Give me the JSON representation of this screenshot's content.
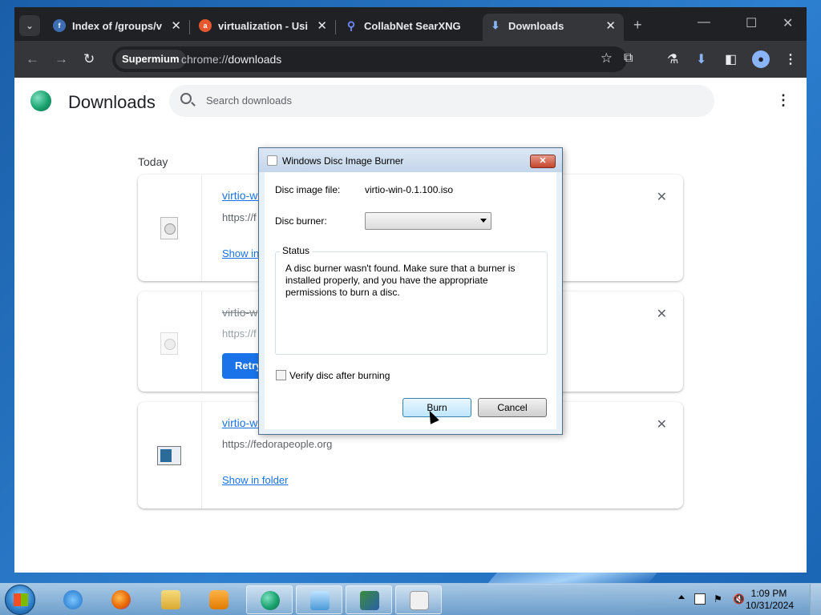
{
  "browser": {
    "tabs": [
      {
        "label": "Index of /groups/virt",
        "favicon": "fedora-icon",
        "color": "#3c6eb4"
      },
      {
        "label": "virtualization - Using",
        "favicon": "askfedora-icon",
        "color": "#e8572e"
      },
      {
        "label": "CollabNet SearXNG",
        "favicon": "search-icon",
        "color": "#3050ff"
      },
      {
        "label": "Downloads",
        "favicon": "download-icon",
        "color": "#8ab4f8"
      }
    ],
    "omnibox": {
      "chip": "Supermium",
      "url_scheme": "chrome://",
      "url_path": "downloads"
    }
  },
  "downloads": {
    "title": "Downloads",
    "search_placeholder": "Search downloads",
    "date_header": "Today",
    "items": [
      {
        "name": "virtio-wi",
        "url": "https://f",
        "action": "Show in"
      },
      {
        "name": "virtio-w",
        "url": "https://f",
        "action": "Retry"
      },
      {
        "name": "virtio-wi",
        "url": "https://fedorapeople.org",
        "action": "Show in folder"
      }
    ]
  },
  "dialog": {
    "title": "Windows Disc Image Burner",
    "disc_image_label": "Disc image file:",
    "disc_image_value": "virtio-win-0.1.100.iso",
    "burner_label": "Disc burner:",
    "burner_value": "",
    "status_legend": "Status",
    "status_text": "A disc burner wasn't found. Make sure that a burner is installed properly, and you have the appropriate permissions to burn a disc.",
    "verify_label": "Verify disc after burning",
    "verify_checked": false,
    "burn_label": "Burn",
    "cancel_label": "Cancel"
  },
  "taskbar": {
    "time": "1:09 PM",
    "date": "10/31/2024"
  }
}
